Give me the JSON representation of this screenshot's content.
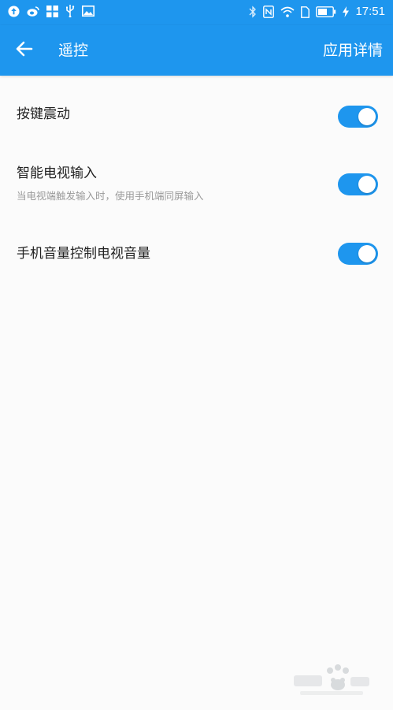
{
  "status_bar": {
    "time": "17:51",
    "left_icons": [
      "upload-icon",
      "weibo-icon",
      "grid-app-icon",
      "usb-icon",
      "image-icon"
    ],
    "right_icons": [
      "bluetooth-icon",
      "nfc-icon",
      "wifi-icon",
      "sim-icon",
      "battery-icon",
      "charging-icon"
    ]
  },
  "app_bar": {
    "back_icon": "arrow-left-icon",
    "title": "遥控",
    "detail_label": "应用详情"
  },
  "settings": [
    {
      "title": "按键震动",
      "subtitle": "",
      "enabled": true
    },
    {
      "title": "智能电视输入",
      "subtitle": "当电视端触发输入时，使用手机端同屏输入",
      "enabled": true
    },
    {
      "title": "手机音量控制电视音量",
      "subtitle": "",
      "enabled": true
    }
  ],
  "colors": {
    "primary": "#1e96ee",
    "background": "#fbfbfb",
    "title_text": "#222222",
    "subtitle_text": "#9a9a9a"
  }
}
